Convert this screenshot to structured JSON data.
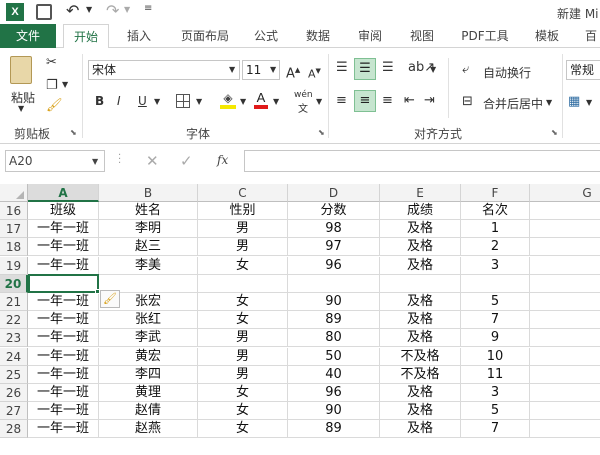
{
  "window": {
    "title": "新建 Mi"
  },
  "tabs": [
    {
      "label": "文件"
    },
    {
      "label": "开始"
    },
    {
      "label": "插入"
    },
    {
      "label": "页面布局"
    },
    {
      "label": "公式"
    },
    {
      "label": "数据"
    },
    {
      "label": "审阅"
    },
    {
      "label": "视图"
    },
    {
      "label": "PDF工具"
    },
    {
      "label": "模板"
    },
    {
      "label": "百"
    }
  ],
  "ribbon": {
    "clipboard": {
      "paste": "粘贴",
      "group": "剪贴板"
    },
    "font": {
      "name": "宋体",
      "size": "11",
      "bold": "B",
      "italic": "I",
      "underline": "U",
      "phonetic": "wén",
      "group": "字体"
    },
    "align": {
      "wrap": "自动换行",
      "merge": "合并后居中",
      "group": "对齐方式"
    },
    "number": {
      "format": "常规"
    }
  },
  "formula": {
    "namebox": "A20",
    "fx": "fx",
    "content": ""
  },
  "columns": [
    "A",
    "B",
    "C",
    "D",
    "E",
    "F",
    "G"
  ],
  "rows": [
    {
      "num": "16",
      "cells": [
        "班级",
        "姓名",
        "性别",
        "分数",
        "成绩",
        "名次"
      ]
    },
    {
      "num": "17",
      "cells": [
        "一年一班",
        "李明",
        "男",
        "98",
        "及格",
        "1"
      ]
    },
    {
      "num": "18",
      "cells": [
        "一年一班",
        "赵三",
        "男",
        "97",
        "及格",
        "2"
      ]
    },
    {
      "num": "19",
      "cells": [
        "一年一班",
        "李美",
        "女",
        "96",
        "及格",
        "3"
      ]
    },
    {
      "num": "20",
      "cells": [
        "",
        "",
        "",
        "",
        "",
        ""
      ]
    },
    {
      "num": "21",
      "cells": [
        "一年一班",
        "张宏",
        "女",
        "90",
        "及格",
        "5"
      ]
    },
    {
      "num": "22",
      "cells": [
        "一年一班",
        "张红",
        "女",
        "89",
        "及格",
        "7"
      ]
    },
    {
      "num": "23",
      "cells": [
        "一年一班",
        "李武",
        "男",
        "80",
        "及格",
        "9"
      ]
    },
    {
      "num": "24",
      "cells": [
        "一年一班",
        "黄宏",
        "男",
        "50",
        "不及格",
        "10"
      ]
    },
    {
      "num": "25",
      "cells": [
        "一年一班",
        "李四",
        "男",
        "40",
        "不及格",
        "11"
      ]
    },
    {
      "num": "26",
      "cells": [
        "一年一班",
        "黄理",
        "女",
        "96",
        "及格",
        "3"
      ]
    },
    {
      "num": "27",
      "cells": [
        "一年一班",
        "赵倩",
        "女",
        "90",
        "及格",
        "5"
      ]
    },
    {
      "num": "28",
      "cells": [
        "一年一班",
        "赵燕",
        "女",
        "89",
        "及格",
        "7"
      ]
    }
  ],
  "colors": {
    "accent": "#217346",
    "selected": "#217346"
  }
}
